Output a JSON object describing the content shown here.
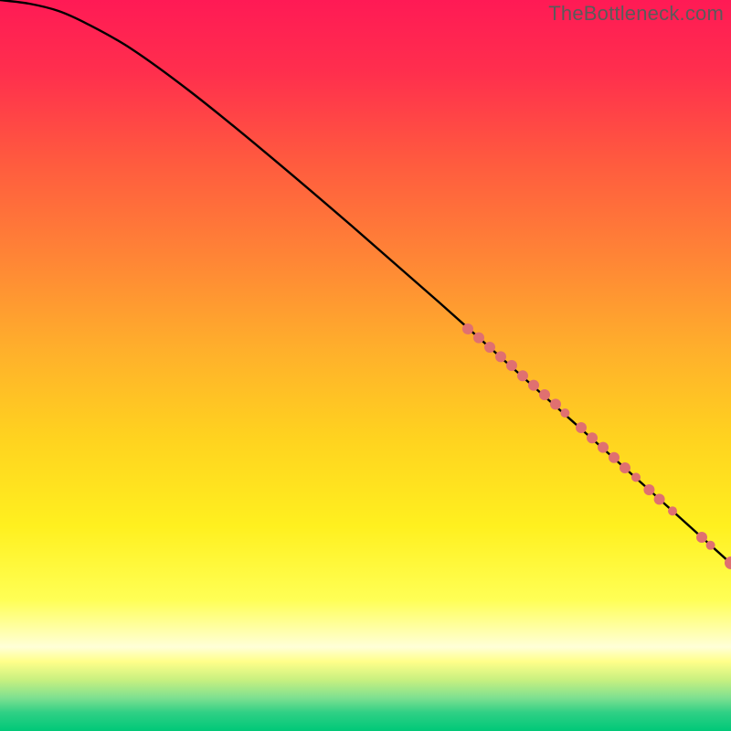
{
  "watermark": "TheBottleneck.com",
  "colors": {
    "curve": "#000000",
    "dot_fill": "#e07070",
    "dot_stroke": "#b04848"
  },
  "chart_data": {
    "type": "line",
    "title": "",
    "xlabel": "",
    "ylabel": "",
    "xlim": [
      0,
      100
    ],
    "ylim": [
      0,
      100
    ],
    "background_gradient_stops": [
      {
        "pos": 0.0,
        "color": "#ff1a55"
      },
      {
        "pos": 0.1,
        "color": "#ff2f4d"
      },
      {
        "pos": 0.22,
        "color": "#ff5a3f"
      },
      {
        "pos": 0.35,
        "color": "#ff8436"
      },
      {
        "pos": 0.48,
        "color": "#ffb02b"
      },
      {
        "pos": 0.6,
        "color": "#ffd31f"
      },
      {
        "pos": 0.72,
        "color": "#fff01f"
      },
      {
        "pos": 0.82,
        "color": "#ffff55"
      },
      {
        "pos": 0.885,
        "color": "#ffffd8"
      },
      {
        "pos": 0.905,
        "color": "#ffff8a"
      },
      {
        "pos": 0.93,
        "color": "#c8f080"
      },
      {
        "pos": 0.955,
        "color": "#7de090"
      },
      {
        "pos": 0.975,
        "color": "#2fd085"
      },
      {
        "pos": 1.0,
        "color": "#00c878"
      }
    ],
    "series": [
      {
        "name": "curve",
        "x": [
          0,
          4,
          8,
          12,
          18,
          26,
          36,
          48,
          60,
          72,
          84,
          96,
          100
        ],
        "y": [
          100,
          99.5,
          98.5,
          96.7,
          93.3,
          87.5,
          79.4,
          69.2,
          58.7,
          48.0,
          37.3,
          26.5,
          22.9
        ]
      }
    ],
    "dots_on_curve": [
      {
        "x": 64.0,
        "y": 55.0,
        "r": 6
      },
      {
        "x": 65.5,
        "y": 53.8,
        "r": 6
      },
      {
        "x": 67.0,
        "y": 52.5,
        "r": 6
      },
      {
        "x": 68.5,
        "y": 51.2,
        "r": 6
      },
      {
        "x": 70.0,
        "y": 50.0,
        "r": 6
      },
      {
        "x": 71.5,
        "y": 48.6,
        "r": 6
      },
      {
        "x": 73.0,
        "y": 47.3,
        "r": 6
      },
      {
        "x": 74.5,
        "y": 46.0,
        "r": 6
      },
      {
        "x": 76.0,
        "y": 44.7,
        "r": 6
      },
      {
        "x": 77.3,
        "y": 43.5,
        "r": 5
      },
      {
        "x": 79.5,
        "y": 41.5,
        "r": 6
      },
      {
        "x": 81.0,
        "y": 40.1,
        "r": 6
      },
      {
        "x": 82.5,
        "y": 38.8,
        "r": 6
      },
      {
        "x": 84.0,
        "y": 37.4,
        "r": 6
      },
      {
        "x": 85.5,
        "y": 36.0,
        "r": 6
      },
      {
        "x": 87.0,
        "y": 34.7,
        "r": 5
      },
      {
        "x": 88.8,
        "y": 33.0,
        "r": 6
      },
      {
        "x": 90.2,
        "y": 31.7,
        "r": 6
      },
      {
        "x": 92.0,
        "y": 30.1,
        "r": 5
      },
      {
        "x": 96.0,
        "y": 26.5,
        "r": 6
      },
      {
        "x": 97.2,
        "y": 25.4,
        "r": 5
      },
      {
        "x": 100.0,
        "y": 23.0,
        "r": 7
      }
    ]
  }
}
